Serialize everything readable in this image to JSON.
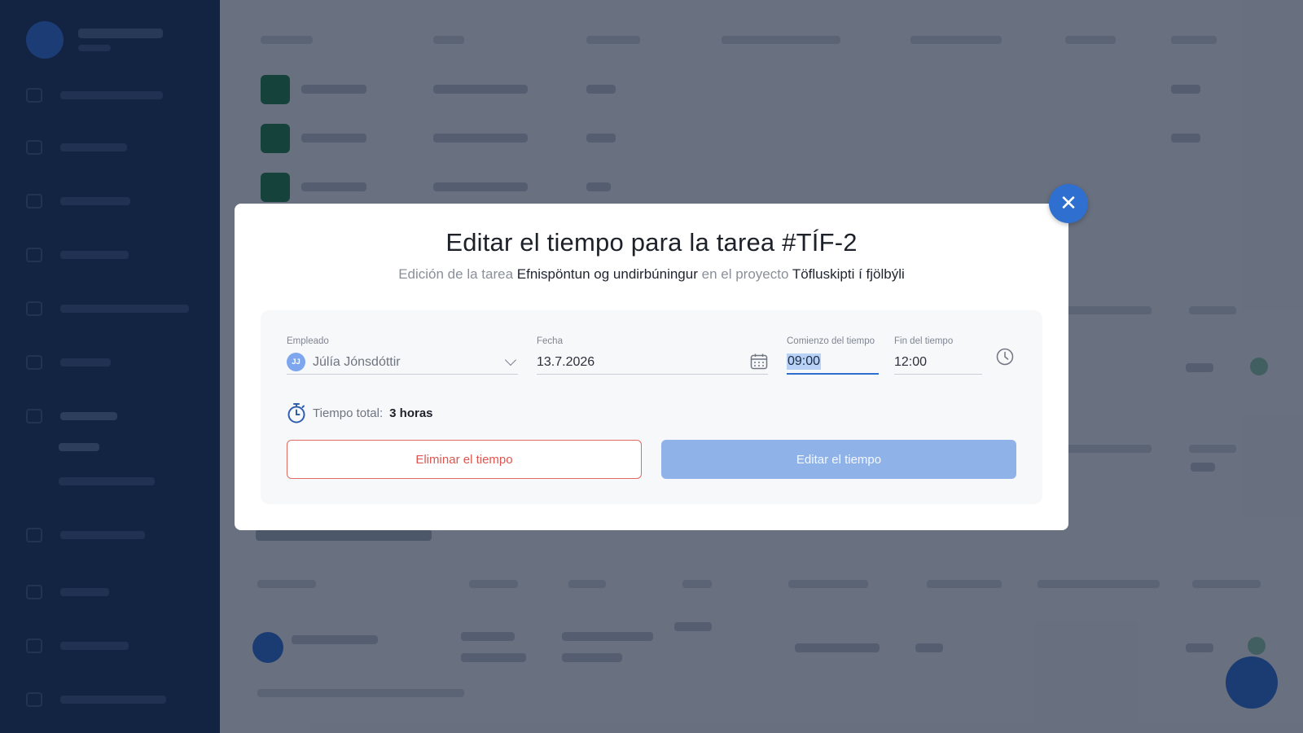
{
  "modal": {
    "title": "Editar el tiempo para la tarea #TÍF-2",
    "subtitle_prefix": "Edición de la tarea",
    "task_name": "Efnispöntun og undirbúningur",
    "subtitle_middle": "en el proyecto",
    "project_name": "Töfluskipti í fjölbýli",
    "close_icon": "close-icon"
  },
  "form": {
    "employee_label": "Empleado",
    "employee_initials": "JJ",
    "employee_name": "Júlía Jónsdóttir",
    "date_label": "Fecha",
    "date_value": "13.7.2026",
    "start_label": "Comienzo del tiempo",
    "start_value": "09:00",
    "end_label": "Fin del tiempo",
    "end_value": "12:00",
    "total_label": "Tiempo total:",
    "total_value": "3 horas"
  },
  "buttons": {
    "delete_label": "Eliminar el tiempo",
    "save_label": "Editar el tiempo"
  },
  "colors": {
    "accent": "#2f6fcf",
    "danger": "#e0554e",
    "primary_disabled": "#8fb3e8",
    "sidebar": "#16305c"
  }
}
